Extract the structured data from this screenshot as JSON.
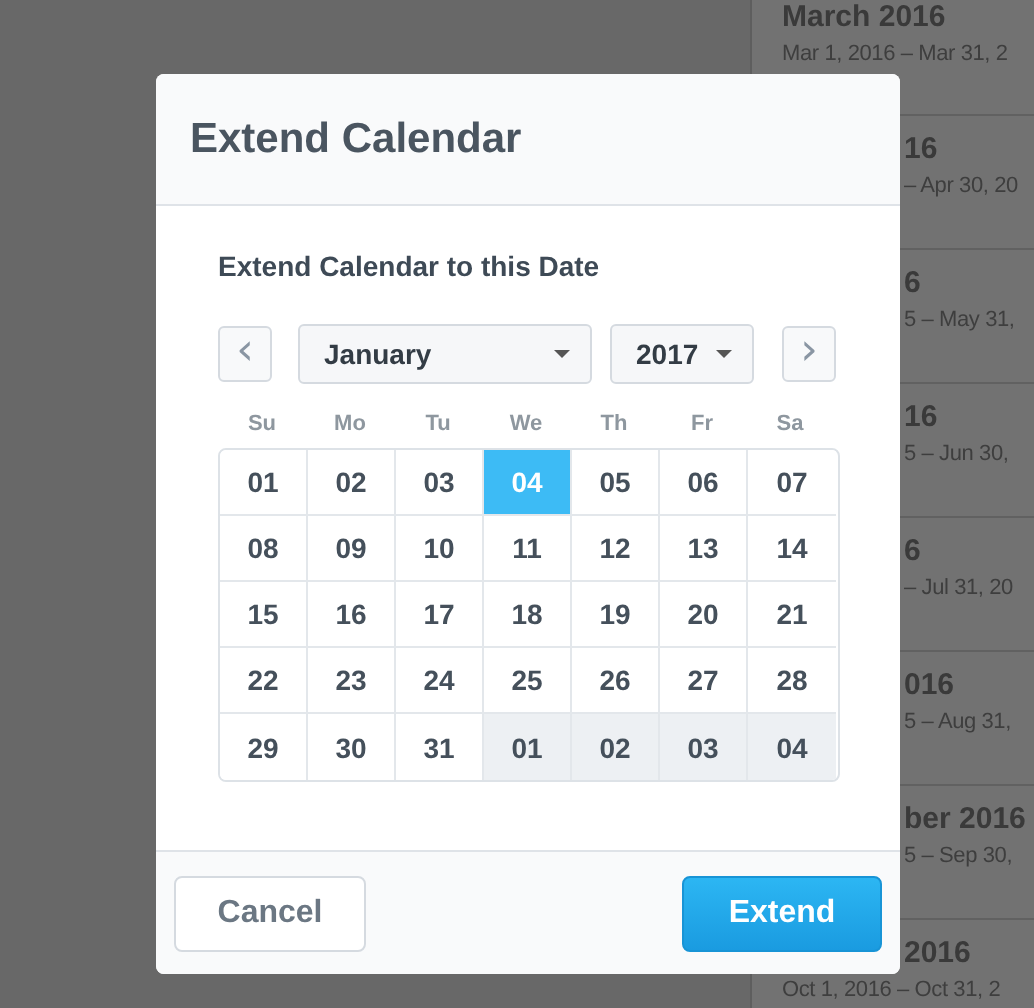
{
  "background_list": [
    {
      "title": "March 2016",
      "dates": "Mar 1, 2016 – Mar 31, 2",
      "kind": "open"
    },
    {
      "title": "16",
      "dates": "– Apr 30, 20",
      "kind": "covered"
    },
    {
      "title": "6",
      "dates": "5 – May 31,",
      "kind": "covered"
    },
    {
      "title": "16",
      "dates": "5 – Jun 30,",
      "kind": "covered"
    },
    {
      "title": "6",
      "dates": "– Jul 31, 20",
      "kind": "covered"
    },
    {
      "title": "016",
      "dates": "5 – Aug 31,",
      "kind": "covered"
    },
    {
      "title": "ber 2016",
      "dates": "5 – Sep 30,",
      "kind": "covered"
    },
    {
      "title": "2016",
      "dates": "Oct 1, 2016 – Oct 31, 2",
      "kind": "title_covered"
    }
  ],
  "dialog": {
    "title": "Extend Calendar",
    "label": "Extend Calendar to this Date",
    "prev": "‹",
    "next": "›",
    "month": "January",
    "year": "2017",
    "weekdays": [
      "Su",
      "Mo",
      "Tu",
      "We",
      "Th",
      "Fr",
      "Sa"
    ],
    "weeks": [
      [
        {
          "label": "01",
          "selected": false,
          "outside_month": false
        },
        {
          "label": "02",
          "selected": false,
          "outside_month": false
        },
        {
          "label": "03",
          "selected": false,
          "outside_month": false
        },
        {
          "label": "04",
          "selected": true,
          "outside_month": false
        },
        {
          "label": "05",
          "selected": false,
          "outside_month": false
        },
        {
          "label": "06",
          "selected": false,
          "outside_month": false
        },
        {
          "label": "07",
          "selected": false,
          "outside_month": false
        }
      ],
      [
        {
          "label": "08",
          "selected": false,
          "outside_month": false
        },
        {
          "label": "09",
          "selected": false,
          "outside_month": false
        },
        {
          "label": "10",
          "selected": false,
          "outside_month": false
        },
        {
          "label": "11",
          "selected": false,
          "outside_month": false
        },
        {
          "label": "12",
          "selected": false,
          "outside_month": false
        },
        {
          "label": "13",
          "selected": false,
          "outside_month": false
        },
        {
          "label": "14",
          "selected": false,
          "outside_month": false
        }
      ],
      [
        {
          "label": "15",
          "selected": false,
          "outside_month": false
        },
        {
          "label": "16",
          "selected": false,
          "outside_month": false
        },
        {
          "label": "17",
          "selected": false,
          "outside_month": false
        },
        {
          "label": "18",
          "selected": false,
          "outside_month": false
        },
        {
          "label": "19",
          "selected": false,
          "outside_month": false
        },
        {
          "label": "20",
          "selected": false,
          "outside_month": false
        },
        {
          "label": "21",
          "selected": false,
          "outside_month": false
        }
      ],
      [
        {
          "label": "22",
          "selected": false,
          "outside_month": false
        },
        {
          "label": "23",
          "selected": false,
          "outside_month": false
        },
        {
          "label": "24",
          "selected": false,
          "outside_month": false
        },
        {
          "label": "25",
          "selected": false,
          "outside_month": false
        },
        {
          "label": "26",
          "selected": false,
          "outside_month": false
        },
        {
          "label": "27",
          "selected": false,
          "outside_month": false
        },
        {
          "label": "28",
          "selected": false,
          "outside_month": false
        }
      ],
      [
        {
          "label": "29",
          "selected": false,
          "outside_month": false
        },
        {
          "label": "30",
          "selected": false,
          "outside_month": false
        },
        {
          "label": "31",
          "selected": false,
          "outside_month": false
        },
        {
          "label": "01",
          "selected": false,
          "outside_month": true
        },
        {
          "label": "02",
          "selected": false,
          "outside_month": true
        },
        {
          "label": "03",
          "selected": false,
          "outside_month": true
        },
        {
          "label": "04",
          "selected": false,
          "outside_month": true
        }
      ]
    ],
    "buttons": [
      {
        "label": "Cancel",
        "kind": "secondary"
      },
      {
        "label": "Extend",
        "kind": "primary"
      }
    ]
  }
}
